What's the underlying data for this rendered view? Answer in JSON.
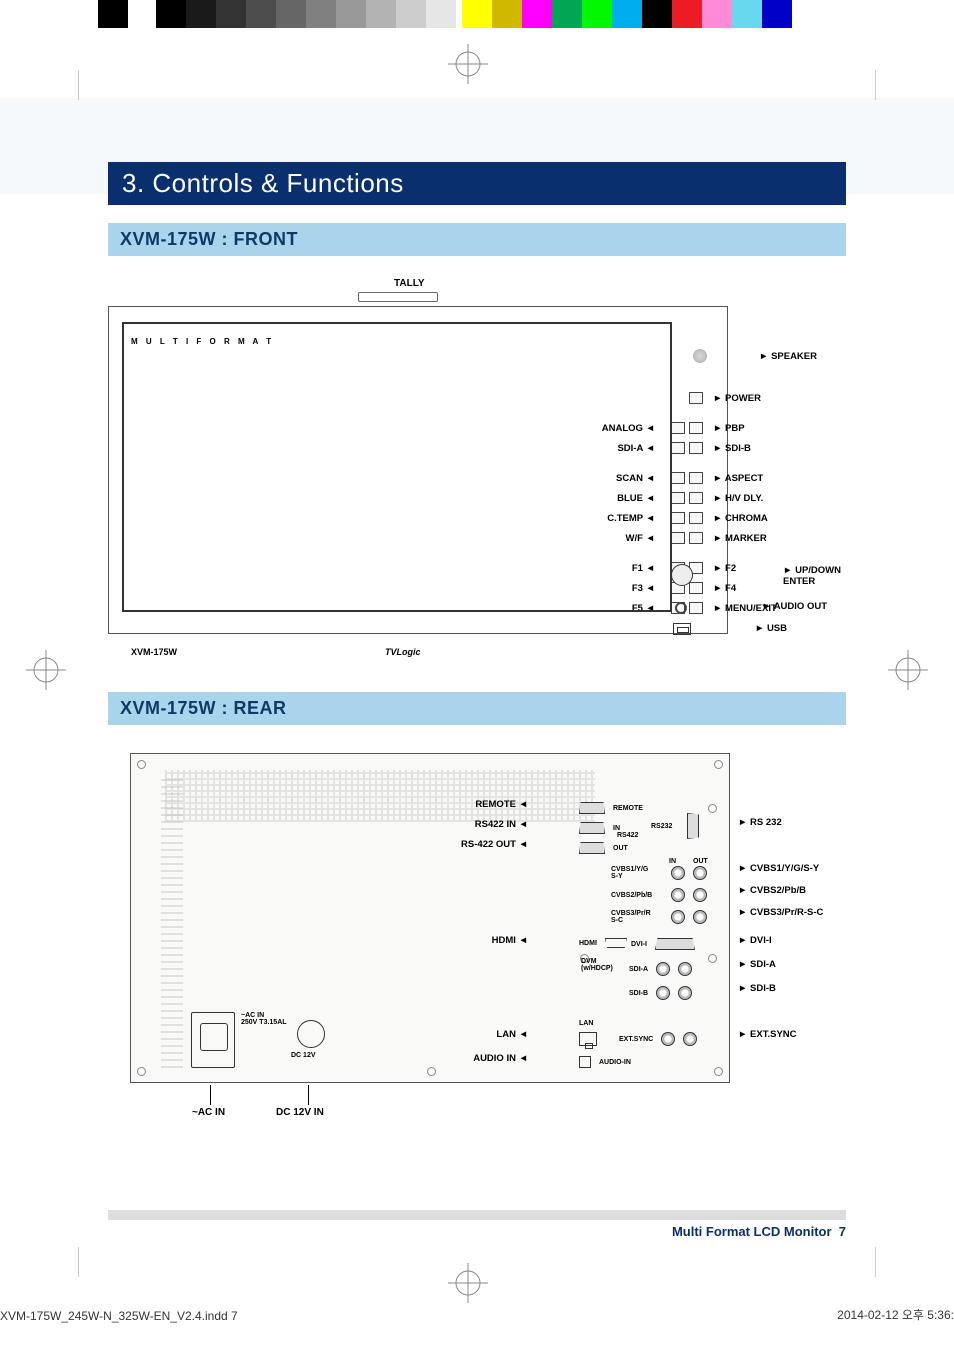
{
  "section_title": "3. Controls & Functions",
  "front": {
    "subhead": "XVM-175W : FRONT",
    "tally": "TALLY",
    "multi_format": "M U L T I   F O R M A T",
    "model": "XVM-175W",
    "logo": "TVLogic",
    "speaker": "SPEAKER",
    "left": [
      "",
      "ANALOG",
      "SDI-A",
      "SCAN",
      "BLUE",
      "C.TEMP",
      "W/F",
      "F1",
      "F3",
      "F5"
    ],
    "right": [
      "POWER",
      "PBP",
      "SDI-B",
      "ASPECT",
      "H/V DLY.",
      "CHROMA",
      "MARKER",
      "F2",
      "F4",
      "MENU/EXIT"
    ],
    "updown": "UP/DOWN\nENTER",
    "audio_out": "AUDIO OUT",
    "usb": "USB"
  },
  "rear": {
    "subhead": "XVM-175W : REAR",
    "left": [
      "REMOTE",
      "RS422 IN",
      "RS-422 OUT",
      "HDMI",
      "LAN",
      "AUDIO IN"
    ],
    "right": [
      "RS 232",
      "CVBS1/Y/G/S-Y",
      "CVBS2/Pb/B",
      "CVBS3/Pr/R-S-C",
      "DVI-I",
      "SDI-A",
      "SDI-B",
      "EXT.SYNC"
    ],
    "ac_in": "~AC IN",
    "dc_in": "DC 12V IN",
    "ac_label": "~AC IN\n250V T3.15AL",
    "dc_label": "DC 12V",
    "panel_tiny": {
      "remote": "REMOTE",
      "rs422": "RS422",
      "in": "IN",
      "out": "OUT",
      "rs232": "RS232",
      "cvbs1": "CVBS1/Y/G\nS-Y",
      "cvbs2": "CVBS2/Pb/B",
      "cvbs3": "CVBS3/Pr/R\nS-C",
      "dvi": "DVI-I",
      "dvm": "DVM\n(w/HDCP)",
      "sdia": "SDI-A",
      "sdib": "SDI-B",
      "lan": "LAN",
      "ext": "EXT.SYNC",
      "audioin": "AUDIO-IN",
      "hdmi": "HDMI"
    }
  },
  "footer": {
    "title": "Multi Format LCD Monitor",
    "page": "7"
  },
  "indd": "XVM-175W_245W-N_325W-EN_V2.4.indd   7",
  "timestamp": "2014-02-12   오후 5:36:"
}
